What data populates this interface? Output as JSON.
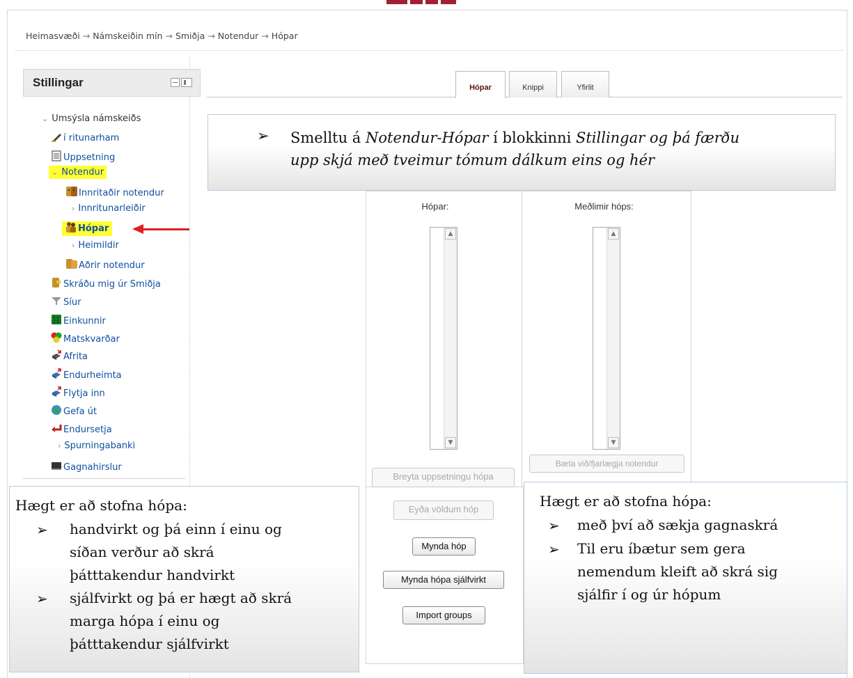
{
  "breadcrumb": {
    "items": [
      "Heimasvæði",
      "Námskeiðin mín",
      "Smiðja",
      "Notendur",
      "Hópar"
    ],
    "separator": "→"
  },
  "sidebar": {
    "title": "Stillingar",
    "items": [
      {
        "label": "Umsýsla námskeiðs",
        "icon": "chevron-down-icon"
      },
      {
        "label": "í ritunarham",
        "icon": "pencil-icon"
      },
      {
        "label": "Uppsetning",
        "icon": "settings-document-icon"
      },
      {
        "label": "Notendur",
        "icon": "chevron-down-icon"
      },
      {
        "label": "Innritaðir notendur",
        "icon": "users-icon"
      },
      {
        "label": "Innritunarleiðir",
        "icon": "chevron-right-icon"
      },
      {
        "label": "Hópar",
        "icon": "group-icon"
      },
      {
        "label": "Heimildir",
        "icon": "chevron-right-icon"
      },
      {
        "label": "Aðrir notendur",
        "icon": "other-users-icon"
      },
      {
        "label": "Skráðu mig úr Smiðja",
        "icon": "unenrol-icon"
      },
      {
        "label": "Síur",
        "icon": "filter-icon"
      },
      {
        "label": "Einkunnir",
        "icon": "grades-icon"
      },
      {
        "label": "Matskvarðar",
        "icon": "scales-icon"
      },
      {
        "label": "Afrita",
        "icon": "backup-icon"
      },
      {
        "label": "Endurheimta",
        "icon": "restore-icon"
      },
      {
        "label": "Flytja inn",
        "icon": "import-icon"
      },
      {
        "label": "Gefa út",
        "icon": "publish-icon"
      },
      {
        "label": "Endursetja",
        "icon": "reset-icon"
      },
      {
        "label": "Spurningabanki",
        "icon": "chevron-right-icon"
      },
      {
        "label": "Gagnahirslur",
        "icon": "repository-icon"
      }
    ]
  },
  "tabs": [
    "Hópar",
    "Knippi",
    "Yfirlit"
  ],
  "callout_top": {
    "part1": "Smelltu á ",
    "part2": "Notendur-Hópar",
    "part3": " í blokkinni ",
    "part4": "Stillingar og þá færðu",
    "line2": "upp skjá með tveimur tómum dálkum eins og hér"
  },
  "groups": {
    "groups_label": "Hópar:",
    "members_label": "Meðlimir hóps:",
    "btn_edit_settings": "Breyta uppsetningu hópa",
    "btn_delete": "Eyða völdum hóp",
    "btn_create": "Mynda hóp",
    "btn_auto_create": "Mynda hópa sjálfvirkt",
    "btn_import": "Import groups",
    "btn_add_remove_users": "Bæta við/fjarlægja notendur"
  },
  "callout_left": {
    "heading": "Hægt er að stofna hópa:",
    "b1_line1": "handvirkt og þá einn í einu og",
    "b1_line2": "síðan verður að skrá",
    "b1_line3": "þátttakendur handvirkt",
    "b2_line1": "sjálfvirkt og þá er hægt að skrá",
    "b2_line2": "marga hópa í einu og",
    "b2_line3": "þátttakendur sjálfvirkt",
    "bullet": "➢"
  },
  "callout_right": {
    "heading": "Hægt er að stofna hópa:",
    "b1_line1": "með því að sækja gagnaskrá",
    "b2_line1": "Til eru íbætur sem gera",
    "b2_line2": "nemendum kleift að skrá sig",
    "b2_line3": "sjálfir í og úr hópum",
    "bullet": "➢"
  },
  "colors": {
    "highlight": "#ffff33",
    "link": "#0f4f9e",
    "arrow": "#e02020",
    "brand": "#a31f34"
  }
}
